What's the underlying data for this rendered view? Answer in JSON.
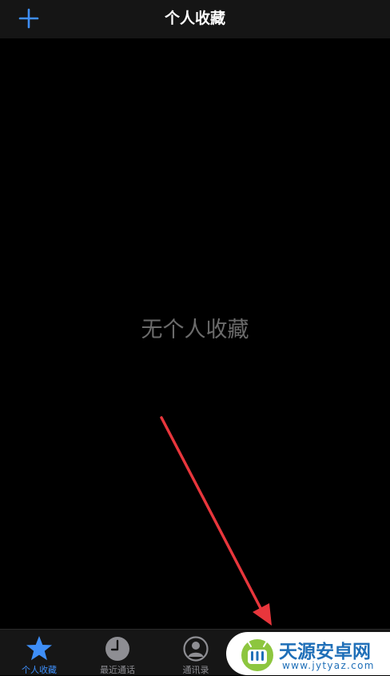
{
  "nav": {
    "title": "个人收藏",
    "add_icon": "plus-icon"
  },
  "main": {
    "empty_message": "无个人收藏"
  },
  "tabs": [
    {
      "label": "个人收藏",
      "icon": "star-icon",
      "active": true
    },
    {
      "label": "最近通话",
      "icon": "clock-icon",
      "active": false
    },
    {
      "label": "通讯录",
      "icon": "person-icon",
      "active": false
    }
  ],
  "watermark": {
    "title": "天源安卓网",
    "url": "www.jytyaz.com",
    "logo_icon": "android-logo-icon"
  },
  "colors": {
    "accent": "#3e8ef7",
    "background": "#000000",
    "bar": "#151515",
    "inactive_tab": "#8e8e93",
    "annotation": "#e8363c",
    "watermark_text": "#1f6fb8"
  }
}
